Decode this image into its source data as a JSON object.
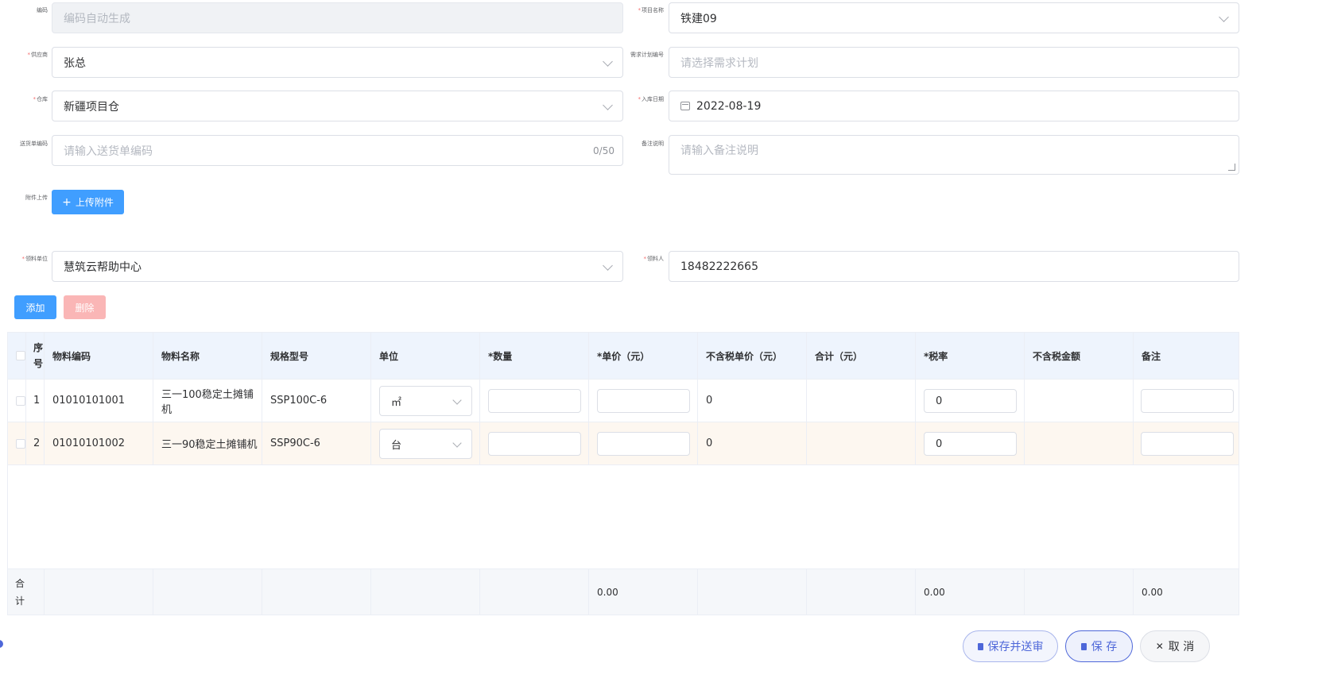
{
  "form": {
    "code": {
      "label": "编码",
      "placeholder": "编码自动生成"
    },
    "project": {
      "label": "项目名称",
      "value": "铁建09"
    },
    "supplier": {
      "label": "供应商",
      "value": "张总"
    },
    "demand_plan": {
      "label": "需求计划编号",
      "placeholder": "请选择需求计划"
    },
    "warehouse": {
      "label": "仓库",
      "value": "新疆项目仓"
    },
    "inbound_date": {
      "label": "入库日期",
      "value": "2022-08-19"
    },
    "delivery_no": {
      "label": "送货单编码",
      "placeholder": "请输入送货单编码",
      "counter": "0/50"
    },
    "remark": {
      "label": "备注说明",
      "placeholder": "请输入备注说明"
    },
    "attachment": {
      "label": "附件上传",
      "button": "上传附件"
    },
    "receiving_unit": {
      "label": "领料单位",
      "value": "慧筑云帮助中心"
    },
    "receiver": {
      "label": "领料人",
      "value": "18482222665"
    }
  },
  "toolbar": {
    "add": "添加",
    "delete": "删除"
  },
  "table": {
    "headers": [
      "序号",
      "物料编码",
      "物料名称",
      "规格型号",
      "单位",
      "*数量",
      "*单价（元）",
      "不含税单价（元）",
      "合计（元）",
      "*税率",
      "不含税金额",
      "备注"
    ],
    "rows": [
      {
        "index": "1",
        "code": "01010101001",
        "name": "三一100稳定土摊铺机",
        "spec": "SSP100C-6",
        "unit": "㎡",
        "price_ex": "0",
        "tax": "0"
      },
      {
        "index": "2",
        "code": "01010101002",
        "name": "三一90稳定土摊铺机",
        "spec": "SSP90C-6",
        "unit": "台",
        "price_ex": "0",
        "tax": "0"
      }
    ],
    "footer": {
      "label": "合计",
      "price_total": "0.00",
      "tax_total": "0.00",
      "remark_total": "0.00"
    }
  },
  "actions": {
    "save_submit": "保存并送审",
    "save": "保 存",
    "cancel": "取 消"
  },
  "colors": {
    "primary": "#409eff",
    "danger_disabled": "#fab6b6",
    "header_bg": "#eef4fd"
  }
}
